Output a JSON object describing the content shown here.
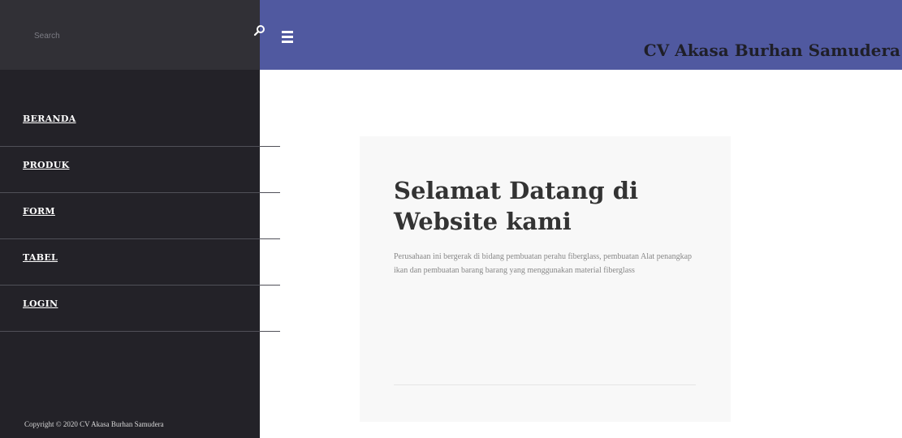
{
  "header": {
    "brand": "CV Akasa Burhan Samudera",
    "menu_icon": "hamburger-menu-icon",
    "background_color": "#5059a0"
  },
  "sidebar": {
    "search": {
      "placeholder": "Search",
      "value": "",
      "icon": "search-icon"
    },
    "items": [
      {
        "label": "BERANDA"
      },
      {
        "label": "PRODUK"
      },
      {
        "label": "FORM"
      },
      {
        "label": "TABEL"
      },
      {
        "label": "LOGIN"
      }
    ],
    "copyright": "Copyright © 2020 CV Akasa Burhan Samudera",
    "background_color": "#232228"
  },
  "main": {
    "card": {
      "title": "Selamat Datang di Website kami",
      "text": "Perusahaan ini bergerak di bidang pembuatan perahu fiberglass, pembuatan Alat penangkap ikan dan pembuatan barang barang yang menggunakan material fiberglass"
    }
  }
}
